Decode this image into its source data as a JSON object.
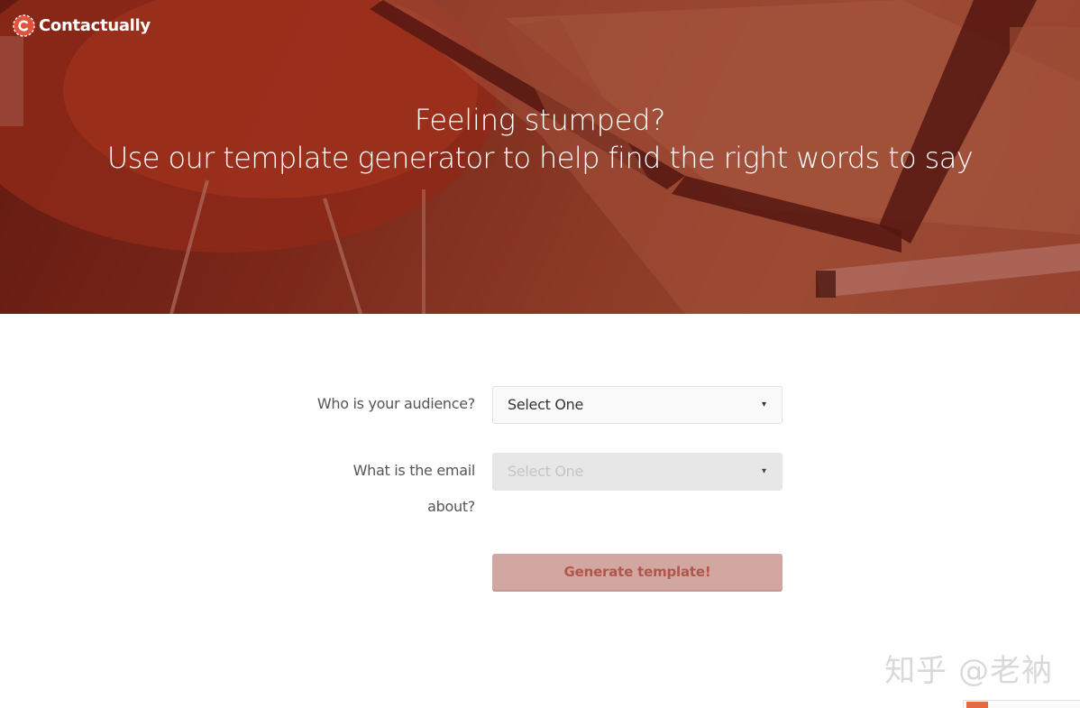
{
  "app": {
    "brand": "Contactually",
    "brand_icon": "contactually-logo-icon",
    "accent_color": "#e0533d"
  },
  "hero": {
    "line1": "Feeling stumped?",
    "line2": "Use our template generator to help find the right words to say"
  },
  "form": {
    "audience": {
      "label": "Who is your audience?",
      "value": "Select One"
    },
    "topic": {
      "label_line1": "What is the email",
      "label_line2": "about?",
      "value": "Select One",
      "disabled": true
    },
    "submit_label": "Generate template!"
  },
  "watermark": "知乎 @老衲"
}
